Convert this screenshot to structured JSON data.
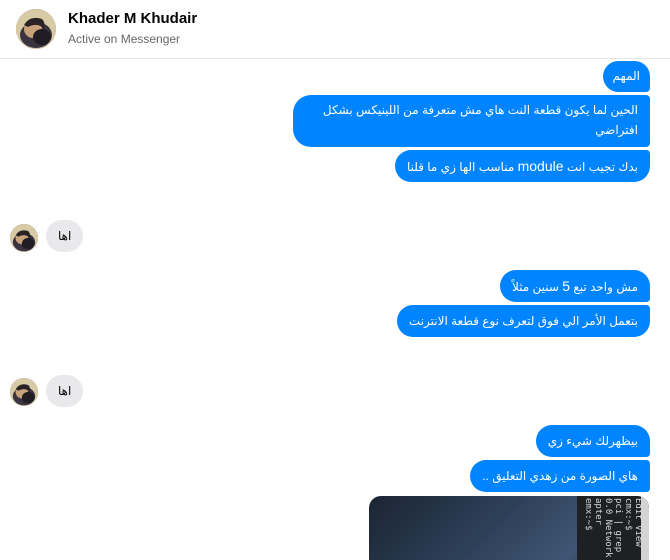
{
  "contact": {
    "name": "Khader M Khudair",
    "status": "Active on Messenger"
  },
  "messages": [
    {
      "dir": "out",
      "text": "المهم"
    },
    {
      "dir": "out",
      "line1": "الحين لما يكون قطعة النت هاي مش متعرفة من اللينيكس بشكل",
      "line2": "افتراضي"
    },
    {
      "dir": "out",
      "pre": "بدك تجيب انت ",
      "lat": "module",
      "post": " مناسب الها زي ما قلنا"
    },
    {
      "dir": "in",
      "text": "اها"
    },
    {
      "dir": "out",
      "pre": "مش واحد تبع ",
      "num": "5",
      "post": " سنين مثلاً"
    },
    {
      "dir": "out",
      "text": "بتعمل الأمر الي فوق لتعرف نوع قطعة الانترنت"
    },
    {
      "dir": "in",
      "text": "اها"
    },
    {
      "dir": "out",
      "text": "بيظهرلك شيء زي"
    },
    {
      "dir": "out",
      "text": "هاي الصورة من زهدي التعليق .."
    }
  ],
  "photo": {
    "terminal_lines": [
      "Edit View",
      "cmx:~$",
      "pci | grep",
      "0.0 Network",
      "apter",
      "emx:~$"
    ]
  },
  "colors": {
    "outgoing_bubble": "#0084ff",
    "incoming_bubble": "#e9e9eb"
  }
}
